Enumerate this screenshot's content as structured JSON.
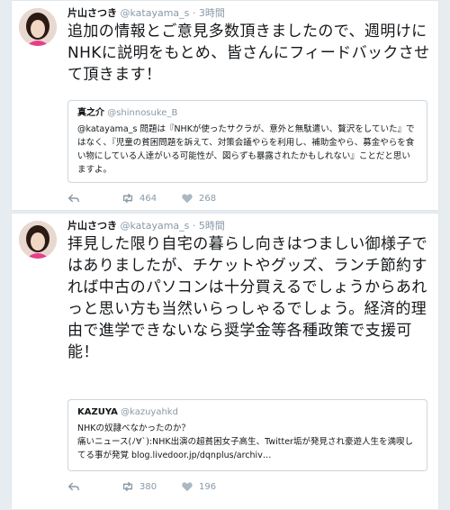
{
  "tweets": [
    {
      "name": "片山さつき",
      "handle": "@katayama_s",
      "time": "3時間",
      "text": "追加の情報とご意見多数頂きましたので、週明けにNHKに説明をもとめ、皆さんにフィードバックさせて頂きます！",
      "quote": {
        "name": "真之介",
        "handle": "@shinnosuke_B",
        "text": "@katayama_s 問題は『NHKが使ったサクラが、意外と無駄遣い、贅沢をしていた』ではなく、『児童の貧困問題を訴えて、対策会議やらを利用し、補助金やら、募金やらを食い物にしている人達がいる可能性が、図らずも暴露されたかもしれない』ことだと思いますよ。"
      },
      "retweets": "464",
      "likes": "268"
    },
    {
      "name": "片山さつき",
      "handle": "@katayama_s",
      "time": "5時間",
      "text": "拝見した限り自宅の暮らし向きはつましい御様子ではありましたが、チケットやグッズ、ランチ節約すれば中古のパソコンは十分買えるでしょうからあれっと思い方も当然いらっしゃるでしょう。経済的理由で進学できないなら奨学金等各種政策で支援可能！",
      "quote": {
        "name": "KAZUYA",
        "handle": "@kazuyahkd",
        "text": "NHKの奴隷べなかったのか？\n痛いニュース(ﾉ∀`):NHK出演の超貧困女子高生、Twitter垢が発見され豪遊人生を満喫してる事が発覚 blog.livedoor.jp/dqnplus/archiv…"
      },
      "retweets": "380",
      "likes": "196"
    }
  ],
  "icons": {
    "reply": "reply-icon",
    "retweet": "retweet-icon",
    "like": "heart-icon"
  },
  "colors": {
    "muted": "#8899a6",
    "border": "#e1e8ed",
    "background": "#e6ecf0"
  }
}
